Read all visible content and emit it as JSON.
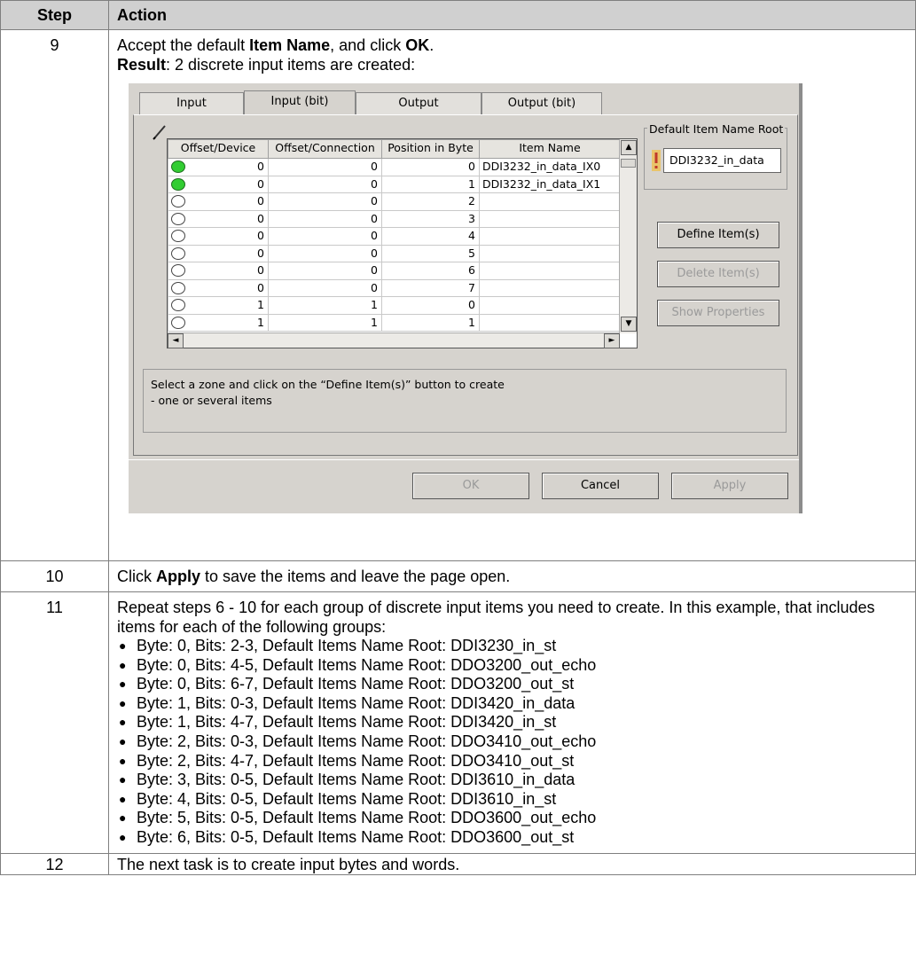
{
  "table": {
    "headers": {
      "step": "Step",
      "action": "Action"
    },
    "step9": {
      "step": "9",
      "line1": {
        "pre": "Accept the default ",
        "item_name": "Item Name",
        "mid": ", and click ",
        "ok": "OK",
        "end": "."
      },
      "line2": {
        "result": "Result",
        "rest": ": 2 discrete input items are created:"
      }
    },
    "step10": {
      "step": "10",
      "pre": "Click ",
      "apply": "Apply",
      "post": " to save the items and leave the page open."
    },
    "step11": {
      "step": "11",
      "intro": "Repeat steps 6 - 10 for each group of discrete input items you need to create. In this example, that includes items for each of the following groups:",
      "bullets": [
        "Byte: 0, Bits: 2-3, Default Items Name Root: DDI3230_in_st",
        "Byte: 0, Bits: 4-5, Default Items Name Root: DDO3200_out_echo",
        "Byte: 0, Bits: 6-7, Default Items Name Root: DDO3200_out_st",
        "Byte: 1, Bits: 0-3, Default Items Name Root: DDI3420_in_data",
        "Byte: 1, Bits: 4-7, Default Items Name Root: DDI3420_in_st",
        "Byte: 2, Bits: 0-3, Default Items Name Root: DDO3410_out_echo",
        "Byte: 2, Bits: 4-7, Default Items Name Root: DDO3410_out_st",
        "Byte: 3, Bits: 0-5, Default Items Name Root: DDI3610_in_data",
        "Byte: 4, Bits: 0-5, Default Items Name Root: DDI3610_in_st",
        "Byte: 5, Bits: 0-5, Default Items Name Root: DDO3600_out_echo",
        "Byte: 6, Bits: 0-5, Default Items Name Root: DDO3600_out_st"
      ]
    },
    "step12": {
      "step": "12",
      "text": "The next task is to create input bytes and words."
    }
  },
  "dialog": {
    "tabs": [
      "Input",
      "Input (bit)",
      "Output",
      "Output (bit)"
    ],
    "active_tab": "Input (bit)",
    "grid": {
      "headers": [
        "Offset/Device",
        "Offset/Connection",
        "Position in Byte",
        "Item Name"
      ],
      "rows": [
        {
          "active": true,
          "offset_device": "0",
          "offset_connection": "0",
          "position": "0",
          "item_name": "DDI3232_in_data_IX0"
        },
        {
          "active": true,
          "offset_device": "0",
          "offset_connection": "0",
          "position": "1",
          "item_name": "DDI3232_in_data_IX1"
        },
        {
          "active": false,
          "offset_device": "0",
          "offset_connection": "0",
          "position": "2",
          "item_name": ""
        },
        {
          "active": false,
          "offset_device": "0",
          "offset_connection": "0",
          "position": "3",
          "item_name": ""
        },
        {
          "active": false,
          "offset_device": "0",
          "offset_connection": "0",
          "position": "4",
          "item_name": ""
        },
        {
          "active": false,
          "offset_device": "0",
          "offset_connection": "0",
          "position": "5",
          "item_name": ""
        },
        {
          "active": false,
          "offset_device": "0",
          "offset_connection": "0",
          "position": "6",
          "item_name": ""
        },
        {
          "active": false,
          "offset_device": "0",
          "offset_connection": "0",
          "position": "7",
          "item_name": ""
        },
        {
          "active": false,
          "offset_device": "1",
          "offset_connection": "1",
          "position": "0",
          "item_name": ""
        },
        {
          "active": false,
          "offset_device": "1",
          "offset_connection": "1",
          "position": "1",
          "item_name": ""
        }
      ]
    },
    "root_label": "Default Item Name Root",
    "root_value": "DDI3232_in_data",
    "buttons": {
      "define": "Define Item(s)",
      "delete": "Delete Item(s)",
      "properties": "Show Properties"
    },
    "hint_line1": "Select a zone and click on the “Define Item(s)” button to create",
    "hint_line2": "- one or several items",
    "footer_buttons": {
      "ok": "OK",
      "cancel": "Cancel",
      "apply": "Apply"
    },
    "colors": {
      "led_on": "#32cd32",
      "dialog_bg": "#d6d3ce",
      "header_bg": "#d0d0d0"
    },
    "icons": [
      "pencil-icon",
      "warning-icon",
      "scroll-up-icon",
      "scroll-down-icon",
      "scroll-left-icon",
      "scroll-right-icon"
    ]
  }
}
